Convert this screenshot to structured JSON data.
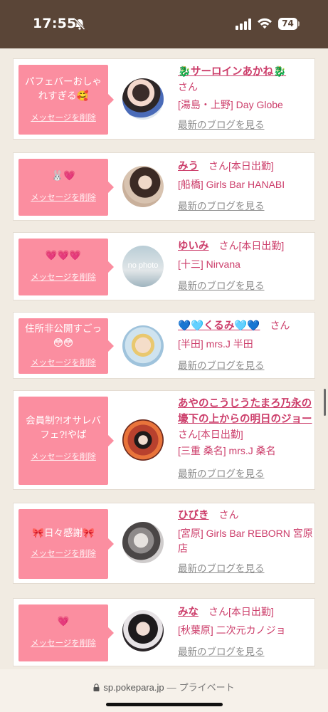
{
  "status_bar": {
    "time": "17:55",
    "battery": "74"
  },
  "browser": {
    "url": "sp.pokepara.jp",
    "separator": "—",
    "mode": "プライベート"
  },
  "common": {
    "delete_label": "メッセージを削除",
    "san": "さん",
    "blog_label": "最新のブログを見る"
  },
  "cards": [
    {
      "message": "パフェバーおしゃれすぎる🥰",
      "name": "🐉サーロインあかね🐉",
      "status": "",
      "shop": "[湯島・上野] Day Globe"
    },
    {
      "message": "🐰💗",
      "name": "みう",
      "status": "[本日出勤]",
      "shop": "[船橋] Girls Bar HANABI"
    },
    {
      "message": "💗💗💗",
      "name": "ゆいみ",
      "status": "[本日出勤]",
      "shop": "[十三] Nirvana",
      "avatar_text": "no photo"
    },
    {
      "message": "住所非公開すごっ😳😳",
      "name": "💙🩵くるみ🩵💙",
      "status": "",
      "shop": "[半田] mrs.J 半田"
    },
    {
      "message": "会員制?!オサレバフェ?!やば",
      "name": "あやのこうじうたまろ乃永の壕下の上からの明日のジョー",
      "status": "[本日出勤]",
      "shop": "[三重 桑名] mrs.J 桑名"
    },
    {
      "message": "🎀日々感謝🎀",
      "name": "ひびき",
      "status": "",
      "shop": "[宮原] Girls Bar REBORN 宮原店"
    },
    {
      "message": "💗",
      "name": "みな",
      "status": "[本日出勤]",
      "shop": "[秋葉原] 二次元カノジョ"
    }
  ]
}
